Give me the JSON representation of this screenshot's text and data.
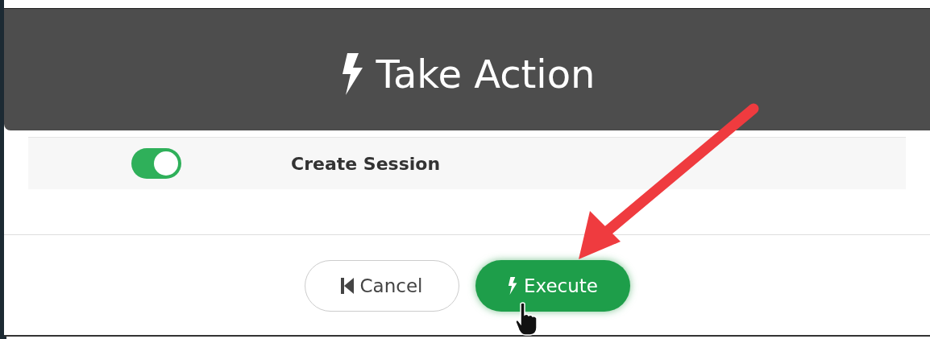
{
  "dialog": {
    "title": "Take Action"
  },
  "actions": [
    {
      "label": "Create Session",
      "on": true
    }
  ],
  "buttons": [
    {
      "label": "Cancel",
      "kind": "cancel"
    },
    {
      "label": "Execute",
      "kind": "execute"
    }
  ]
}
